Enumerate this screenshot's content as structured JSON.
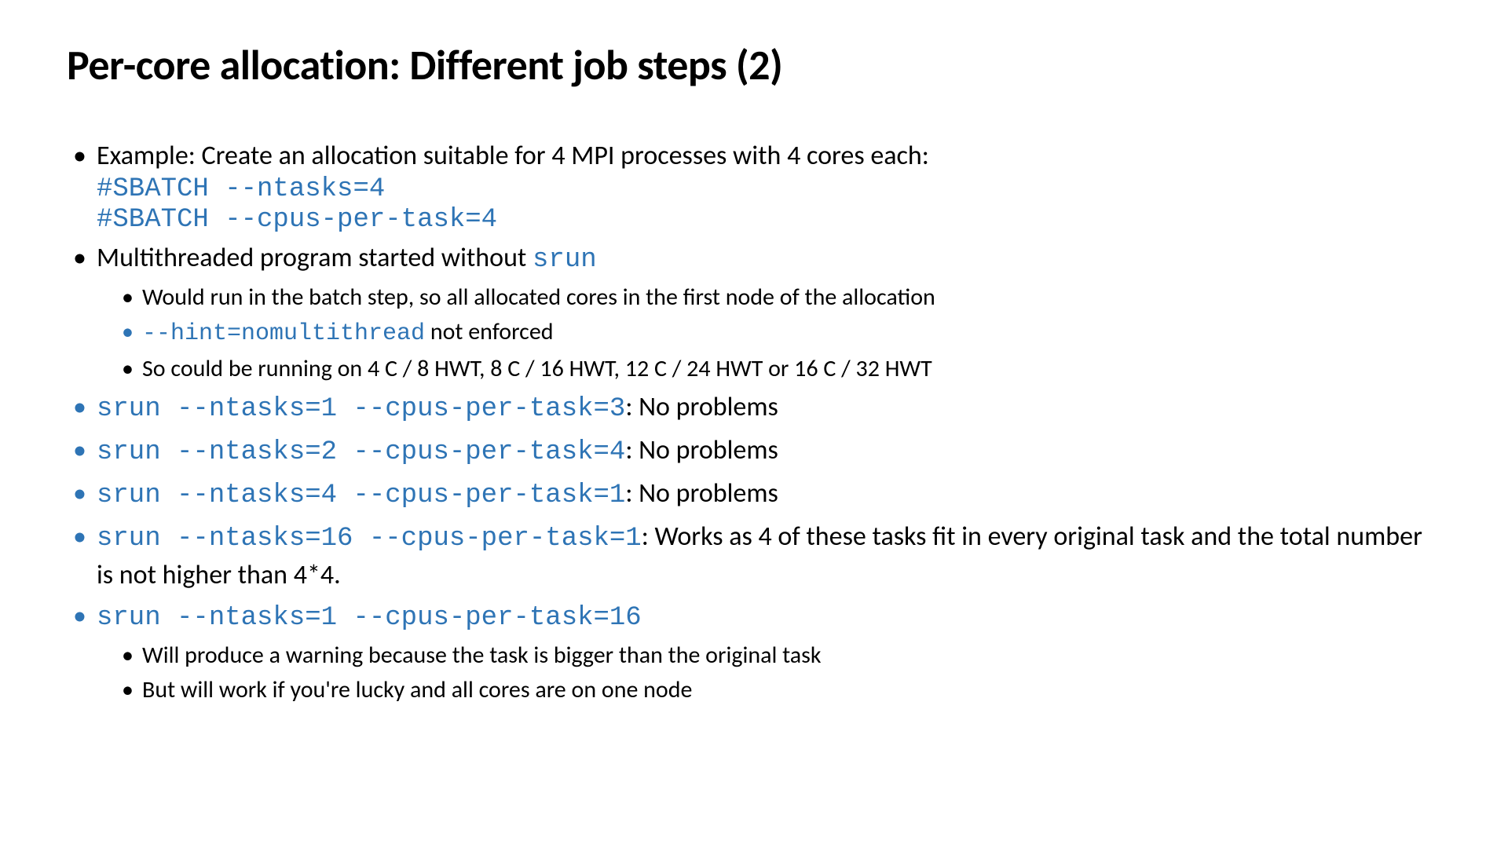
{
  "title": "Per-core allocation: Different job steps (2)",
  "bullets": {
    "b1_text": "Example: Create an allocation suitable for 4 MPI processes with 4 cores each:",
    "b1_code1": "#SBATCH --ntasks=4",
    "b1_code2": "#SBATCH --cpus-per-task=4",
    "b2_text": "Multithreaded program started without ",
    "b2_code": "srun",
    "b2_sub1": "Would run in the batch step, so all allocated cores in the first node of the allocation",
    "b2_sub2_code": "--hint=nomultithread",
    "b2_sub2_text": " not enforced",
    "b2_sub3": "So could be running on 4 C / 8 HWT, 8 C / 16 HWT, 12 C / 24 HWT or 16 C / 32 HWT",
    "b3_code": "srun --ntasks=1 --cpus-per-task=3",
    "b3_text": ": No problems",
    "b4_code": "srun --ntasks=2 --cpus-per-task=4",
    "b4_text": ": No problems",
    "b5_code": "srun --ntasks=4 --cpus-per-task=1",
    "b5_text": ": No problems",
    "b6_code": "srun --ntasks=16 --cpus-per-task=1",
    "b6_text": ": Works as 4 of these tasks fit in every original task and the total number is not higher than 4*4.",
    "b7_code": "srun --ntasks=1 --cpus-per-task=16",
    "b7_sub1": "Will produce a warning because the task is bigger than the original task",
    "b7_sub2": "But will work if you're lucky and all cores are on one node"
  }
}
